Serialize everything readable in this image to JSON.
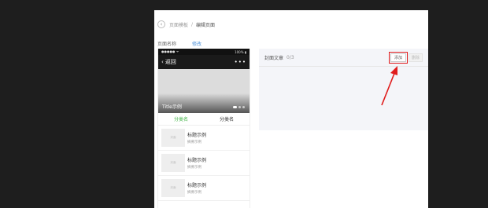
{
  "breadcrumb": {
    "back_glyph": "‹",
    "parent": "页面模板",
    "separator": "/",
    "current": "编辑页面"
  },
  "page_name": {
    "label": "页面名称",
    "action": "修改"
  },
  "phone": {
    "status": {
      "left": "●●●●● ᯤ",
      "right": "100% ▮"
    },
    "nav": {
      "back_icon": "‹",
      "back_label": "返回",
      "more": "•••"
    },
    "banner": {
      "title": "Title示例"
    },
    "tabs": [
      {
        "label": "分类名",
        "active": true
      },
      {
        "label": "分类名",
        "active": false
      }
    ],
    "articles": [
      {
        "thumb": "封面",
        "title": "标题示例",
        "summary": "摘要示例"
      },
      {
        "thumb": "封面",
        "title": "标题示例",
        "summary": "摘要示例"
      },
      {
        "thumb": "封面",
        "title": "标题示例",
        "summary": "摘要示例"
      }
    ]
  },
  "articles_pane": {
    "label": "封面文章",
    "count": "0/3",
    "add_button": "添加",
    "delete_button": "删除"
  },
  "colors": {
    "active_tab": "#44b549",
    "highlight": "#e01c1c",
    "link": "#4a90d9"
  }
}
